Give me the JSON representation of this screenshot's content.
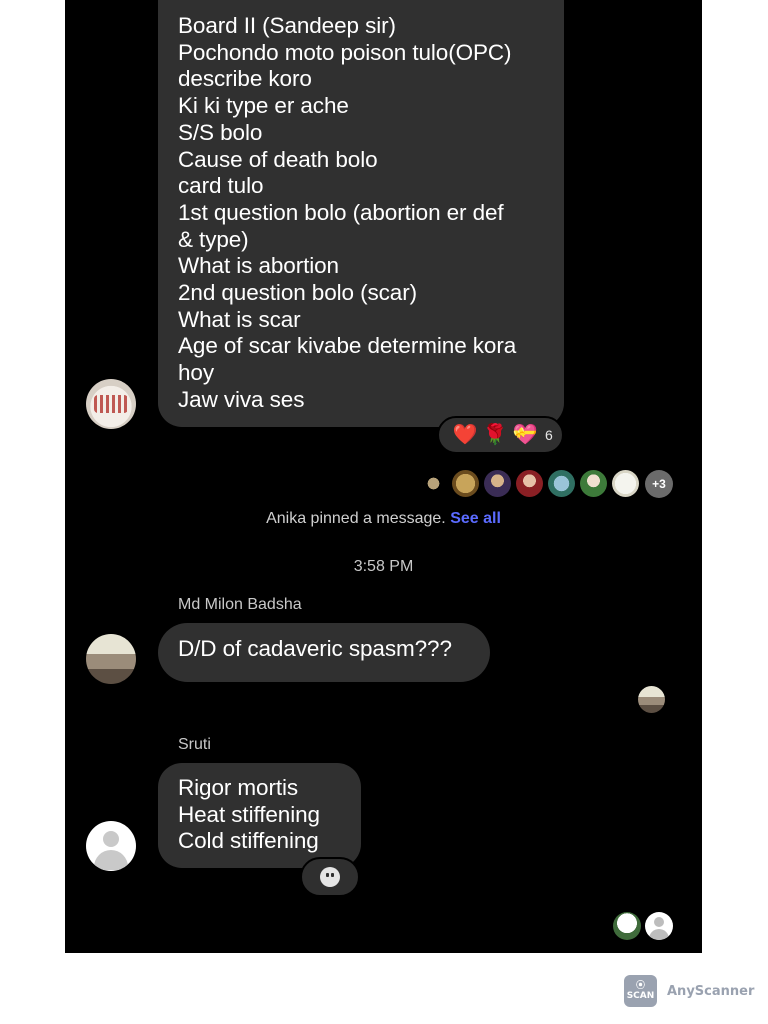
{
  "thread": {
    "message1_lines": [
      "Board II (Sandeep sir)",
      "Pochondo moto poison tulo(OPC)",
      "describe koro",
      "Ki ki type er ache",
      "S/S bolo",
      "Cause of death bolo",
      "card tulo",
      "1st question bolo (abortion er def",
      "& type)",
      "What is abortion",
      "2nd question bolo (scar)",
      "What is scar",
      "Age of scar kivabe determine kora",
      "hoy",
      "Jaw viva ses"
    ],
    "message1_reactions": {
      "emojis": [
        "❤️",
        "🌹",
        "💝"
      ],
      "count": "6"
    },
    "seen_more": "+3",
    "pinned_notice": "Anika pinned a message.",
    "pinned_link": "See all",
    "timestamp": "3:58 PM",
    "message2": {
      "sender": "Md Milon Badsha",
      "text": "D/D of cadaveric spasm???"
    },
    "message3": {
      "sender": "Sruti",
      "lines": [
        "Rigor mortis",
        "Heat stiffening",
        "Cold stiffening"
      ]
    },
    "icons": {
      "add_reaction": "add-reaction-icon",
      "default_avatar": "person-icon"
    }
  },
  "watermark": {
    "logo_lines": [
      "⦿",
      "SCAN"
    ],
    "brand": "AnyScanner"
  },
  "colors": {
    "background": "#000000",
    "bubble": "#303030",
    "link": "#5b6bff",
    "page": "#ffffff"
  }
}
